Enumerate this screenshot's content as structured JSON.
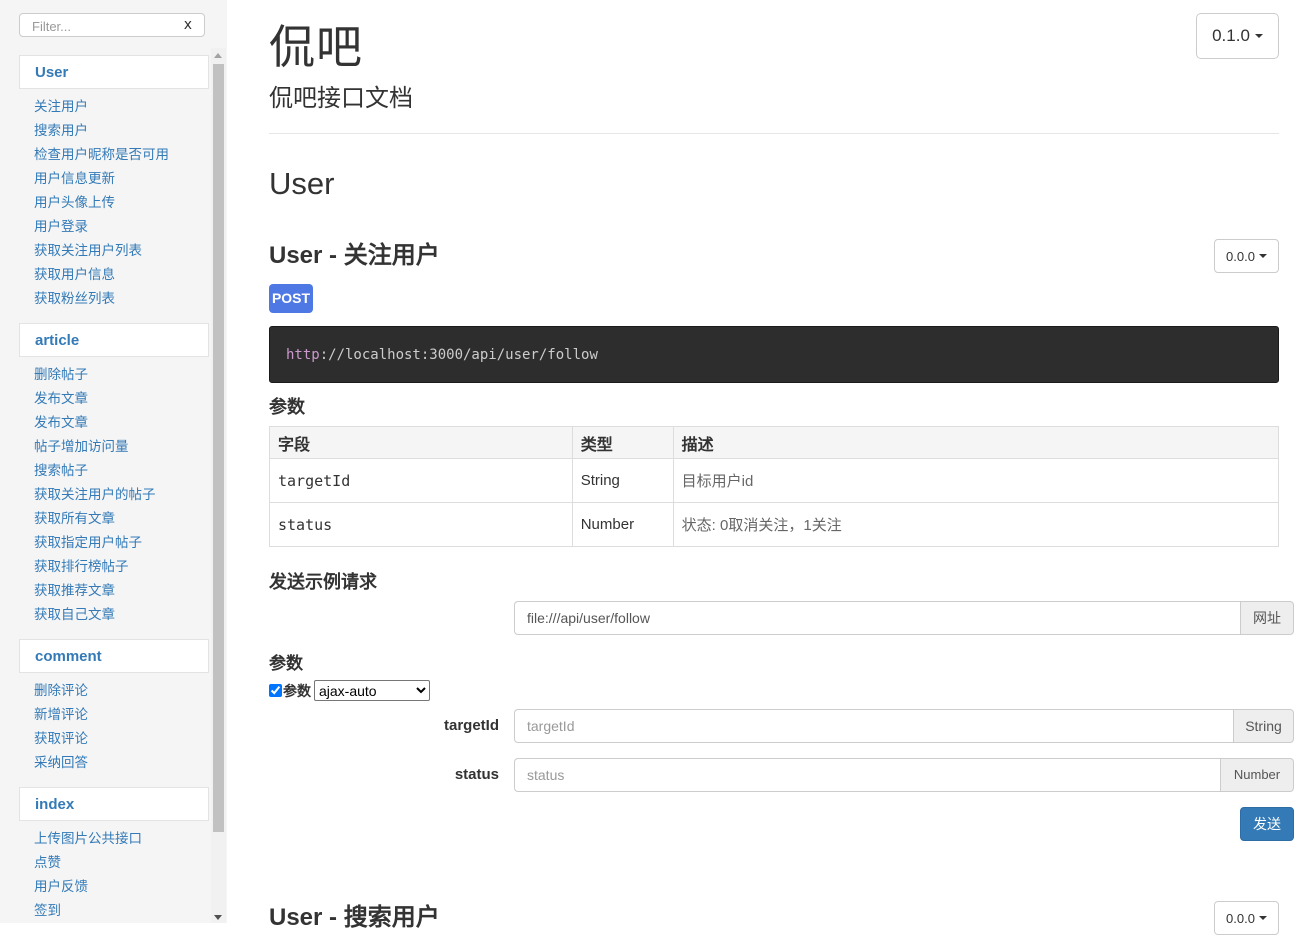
{
  "sidebar": {
    "filter_placeholder": "Filter...",
    "filter_clear": "x",
    "groups": [
      {
        "title": "User",
        "items": [
          "关注用户",
          "搜索用户",
          "检查用户昵称是否可用",
          "用户信息更新",
          "用户头像上传",
          "用户登录",
          "获取关注用户列表",
          "获取用户信息",
          "获取粉丝列表"
        ]
      },
      {
        "title": "article",
        "items": [
          "删除帖子",
          "发布文章",
          "发布文章",
          "帖子增加访问量",
          "搜索帖子",
          "获取关注用户的帖子",
          "获取所有文章",
          "获取指定用户帖子",
          "获取排行榜帖子",
          "获取推荐文章",
          "获取自己文章"
        ]
      },
      {
        "title": "comment",
        "items": [
          "删除评论",
          "新增评论",
          "获取评论",
          "采纳回答"
        ]
      },
      {
        "title": "index",
        "items": [
          "上传图片公共接口",
          "点赞",
          "用户反馈",
          "签到"
        ]
      }
    ]
  },
  "header": {
    "title": "侃吧",
    "description": "侃吧接口文档",
    "version": "0.1.0"
  },
  "section": {
    "title": "User"
  },
  "endpoint": {
    "title": "User - 关注用户",
    "version": "0.0.0",
    "method": "POST",
    "url_protocol": "http",
    "url_rest": "://localhost:3000/api/user/follow",
    "params_heading": "参数",
    "table": {
      "headers": [
        "字段",
        "类型",
        "描述"
      ],
      "rows": [
        {
          "field": "targetId",
          "type": "String",
          "desc": "目标用户id"
        },
        {
          "field": "status",
          "type": "Number",
          "desc": "状态: 0取消关注，1关注"
        }
      ]
    },
    "sample": {
      "heading": "发送示例请求",
      "url_value": "file:///api/user/follow",
      "url_addon": "网址",
      "params_heading": "参数",
      "params_checkbox_label": "参数",
      "mode_selected": "ajax-auto",
      "fields": [
        {
          "label": "targetId",
          "placeholder": "targetId",
          "type": "String"
        },
        {
          "label": "status",
          "placeholder": "status",
          "type": "Number"
        }
      ],
      "send_label": "发送"
    }
  },
  "next_endpoint": {
    "title": "User - 搜索用户",
    "version": "0.0.0"
  },
  "colors": {
    "link": "#337ab7",
    "post_badge": "#4e79e4",
    "code_bg": "#2d2d2d",
    "send_button": "#337ab7"
  }
}
